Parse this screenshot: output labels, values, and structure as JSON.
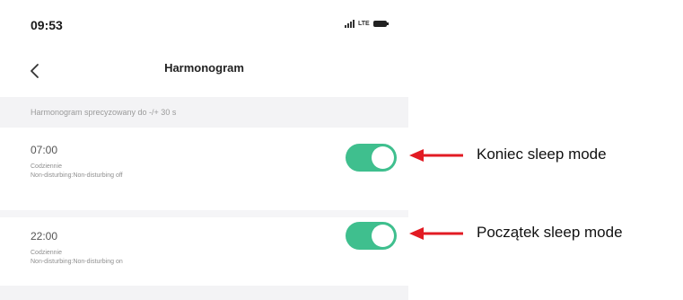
{
  "status_bar": {
    "time": "09:53",
    "network": "LTE"
  },
  "nav": {
    "title": "Harmonogram"
  },
  "info": {
    "text": "Harmonogram sprecyzowany do -/+ 30 s"
  },
  "schedules": [
    {
      "time": "07:00",
      "repeat": "Codziennie",
      "action": "Non-disturbing:Non-disturbing off",
      "enabled": true,
      "annotation": "Koniec sleep mode"
    },
    {
      "time": "22:00",
      "repeat": "Codziennie",
      "action": "Non-disturbing:Non-disturbing on",
      "enabled": true,
      "annotation": "Początek sleep mode"
    }
  ],
  "colors": {
    "toggle_on": "#3fbf8e",
    "arrow": "#e21b23"
  }
}
